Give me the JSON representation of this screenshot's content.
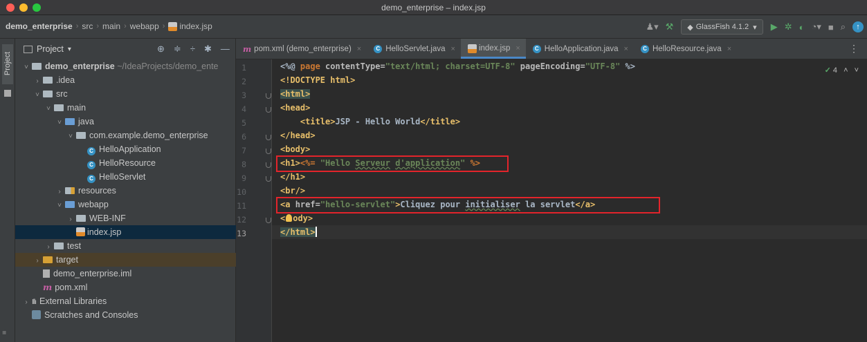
{
  "window": {
    "title": "demo_enterprise – index.jsp"
  },
  "breadcrumb": [
    "demo_enterprise",
    "src",
    "main",
    "webapp",
    "index.jsp"
  ],
  "toolbar": {
    "run_config": "GlassFish 4.1.2"
  },
  "sidebar_strip": {
    "label": "Project"
  },
  "project_panel": {
    "title": "Project",
    "tree": [
      {
        "label": "demo_enterprise",
        "extra": "~/IdeaProjects/demo_ente",
        "icon": "module-folder-icon",
        "arrow": "˅"
      },
      {
        "label": ".idea",
        "icon": "folder-icon",
        "arrow": "›"
      },
      {
        "label": "src",
        "icon": "folder-icon",
        "arrow": "˅"
      },
      {
        "label": "main",
        "icon": "folder-icon",
        "arrow": "˅"
      },
      {
        "label": "java",
        "icon": "source-folder-icon",
        "arrow": "˅"
      },
      {
        "label": "com.example.demo_enterprise",
        "icon": "package-icon",
        "arrow": "˅"
      },
      {
        "label": "HelloApplication",
        "icon": "class-icon",
        "arrow": ""
      },
      {
        "label": "HelloResource",
        "icon": "class-icon",
        "arrow": ""
      },
      {
        "label": "HelloServlet",
        "icon": "class-icon",
        "arrow": ""
      },
      {
        "label": "resources",
        "icon": "resources-folder-icon",
        "arrow": "›"
      },
      {
        "label": "webapp",
        "icon": "web-folder-icon",
        "arrow": "˅"
      },
      {
        "label": "WEB-INF",
        "icon": "folder-icon",
        "arrow": "›"
      },
      {
        "label": "index.jsp",
        "icon": "jsp-file-icon",
        "arrow": ""
      },
      {
        "label": "test",
        "icon": "folder-icon",
        "arrow": "›"
      },
      {
        "label": "target",
        "icon": "excluded-folder-icon",
        "arrow": "›"
      },
      {
        "label": "demo_enterprise.iml",
        "icon": "iml-file-icon",
        "arrow": ""
      },
      {
        "label": "pom.xml",
        "icon": "maven-icon",
        "arrow": ""
      },
      {
        "label": "External Libraries",
        "icon": "libraries-icon",
        "arrow": "›"
      },
      {
        "label": "Scratches and Consoles",
        "icon": "scratches-icon",
        "arrow": ""
      }
    ]
  },
  "tabs": [
    {
      "label": "pom.xml (demo_enterprise)",
      "icon": "maven-icon"
    },
    {
      "label": "HelloServlet.java",
      "icon": "class-icon"
    },
    {
      "label": "index.jsp",
      "icon": "jsp-file-icon",
      "active": true
    },
    {
      "label": "HelloApplication.java",
      "icon": "class-icon"
    },
    {
      "label": "HelloResource.java",
      "icon": "class-icon"
    }
  ],
  "editor": {
    "inspection_count": "4",
    "line_numbers": [
      "1",
      "2",
      "3",
      "4",
      "5",
      "6",
      "7",
      "8",
      "9",
      "10",
      "11",
      "12",
      "13"
    ],
    "lines": {
      "l1_a": "<%@ ",
      "l1_b": "page ",
      "l1_c": "contentType=",
      "l1_d": "\"text/html; charset=UTF-8\"",
      "l1_e": " pageEncoding=",
      "l1_f": "\"UTF-8\"",
      "l1_g": " %>",
      "l2_a": "<!DOCTYPE ",
      "l2_b": "html",
      "l2_c": ">",
      "l3": "<html>",
      "l4": "<head>",
      "l5_a": "    ",
      "l5_b": "<title>",
      "l5_c": "JSP - Hello World",
      "l5_d": "</title>",
      "l6": "</head>",
      "l7": "<body>",
      "l8_a": "<h1>",
      "l8_b": "<%= ",
      "l8_c": "\"Hello ",
      "l8_d": "Serveur",
      "l8_e": " ",
      "l8_f": "d'application",
      "l8_g": "\"",
      "l8_h": " %>",
      "l9": "</h1>",
      "l10": "<br/>",
      "l11_a": "<a ",
      "l11_b": "href=",
      "l11_c": "\"hello-servlet\"",
      "l11_d": ">",
      "l11_e": "Cliquez pour ",
      "l11_f": "initialiser",
      "l11_g": " la servlet",
      "l11_h": "</a>",
      "l12_a": "<",
      "l12_b": "ody>",
      "l13": "</html>"
    }
  }
}
